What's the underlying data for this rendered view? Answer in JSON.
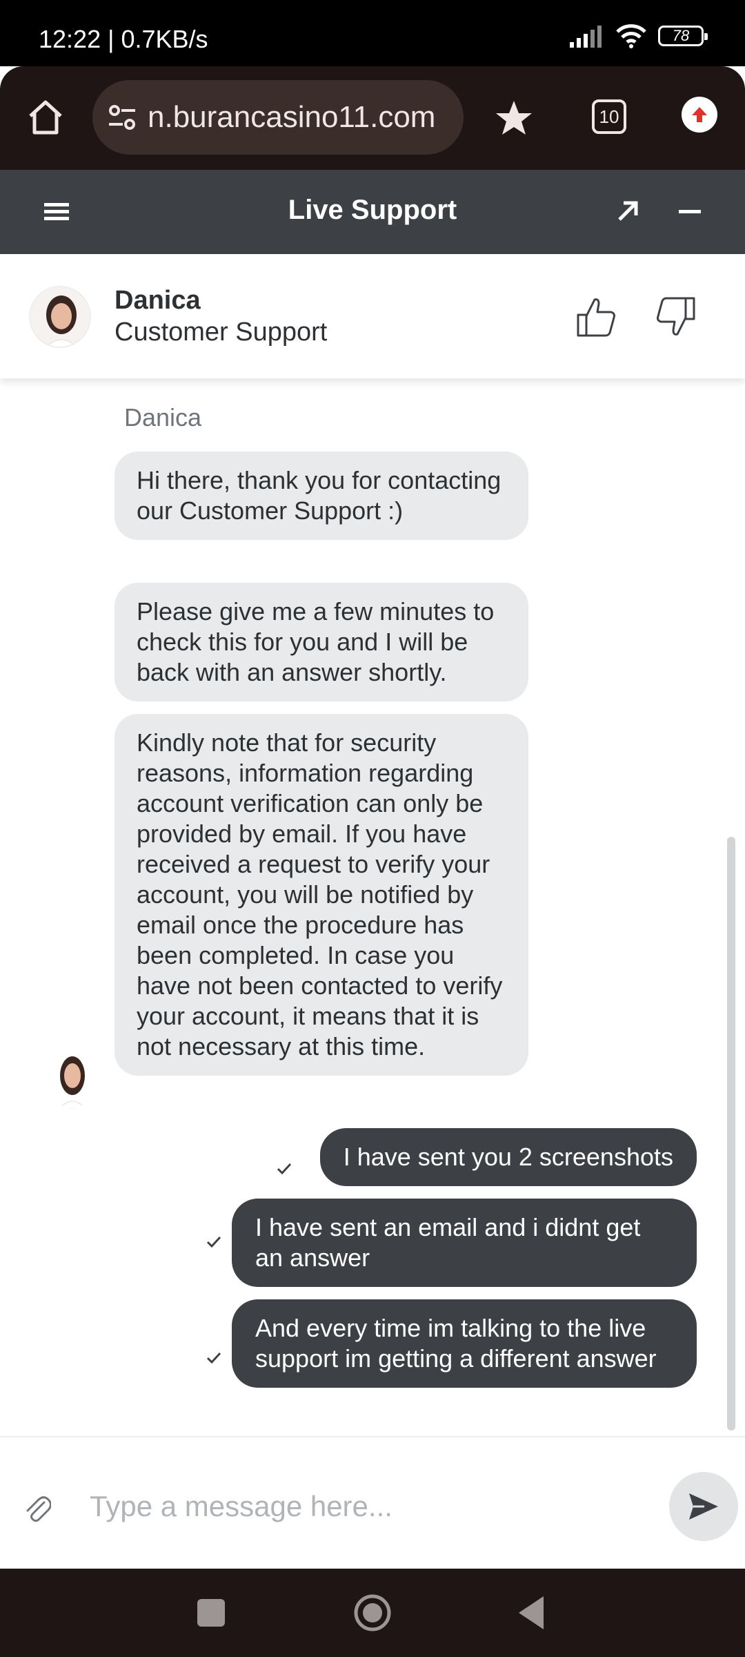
{
  "status_bar": {
    "time": "12:22 | 0.7KB/s",
    "battery": "78"
  },
  "browser": {
    "url": "n.burancasino11.com",
    "tab_count": "10"
  },
  "chat": {
    "header_title": "Live Support",
    "agent": {
      "name": "Danica",
      "role": "Customer Support"
    },
    "sender_label": "Danica",
    "agent_messages": [
      "Hi there, thank you for contacting our Customer Support :)",
      "Please give me a few minutes to check this for you and I will be back with an answer shortly.",
      "Kindly note that for security reasons, information regarding account verification can only be provided by email. If you have received a request to verify your account, you will be notified by email once the procedure has been completed. In case you have not been contacted to verify your account, it means that it is not necessary at this time."
    ],
    "user_messages": [
      "I have sent you 2 screenshots",
      "I have sent an email and i didnt get an answer",
      "And every time im talking to the live support im getting a different answer"
    ],
    "input_placeholder": "Type a message here..."
  },
  "colors": {
    "header_bg": "#3d4145",
    "agent_bubble": "#e9eaeb",
    "user_bubble": "#3d4145",
    "browser_bg": "#1f1514"
  },
  "icons": [
    "home-icon",
    "site-settings-icon",
    "star-icon",
    "tabs-icon",
    "update-icon",
    "menu-icon",
    "popout-icon",
    "minimize-icon",
    "thumbs-up-icon",
    "thumbs-down-icon",
    "check-icon",
    "attach-icon",
    "send-icon"
  ]
}
